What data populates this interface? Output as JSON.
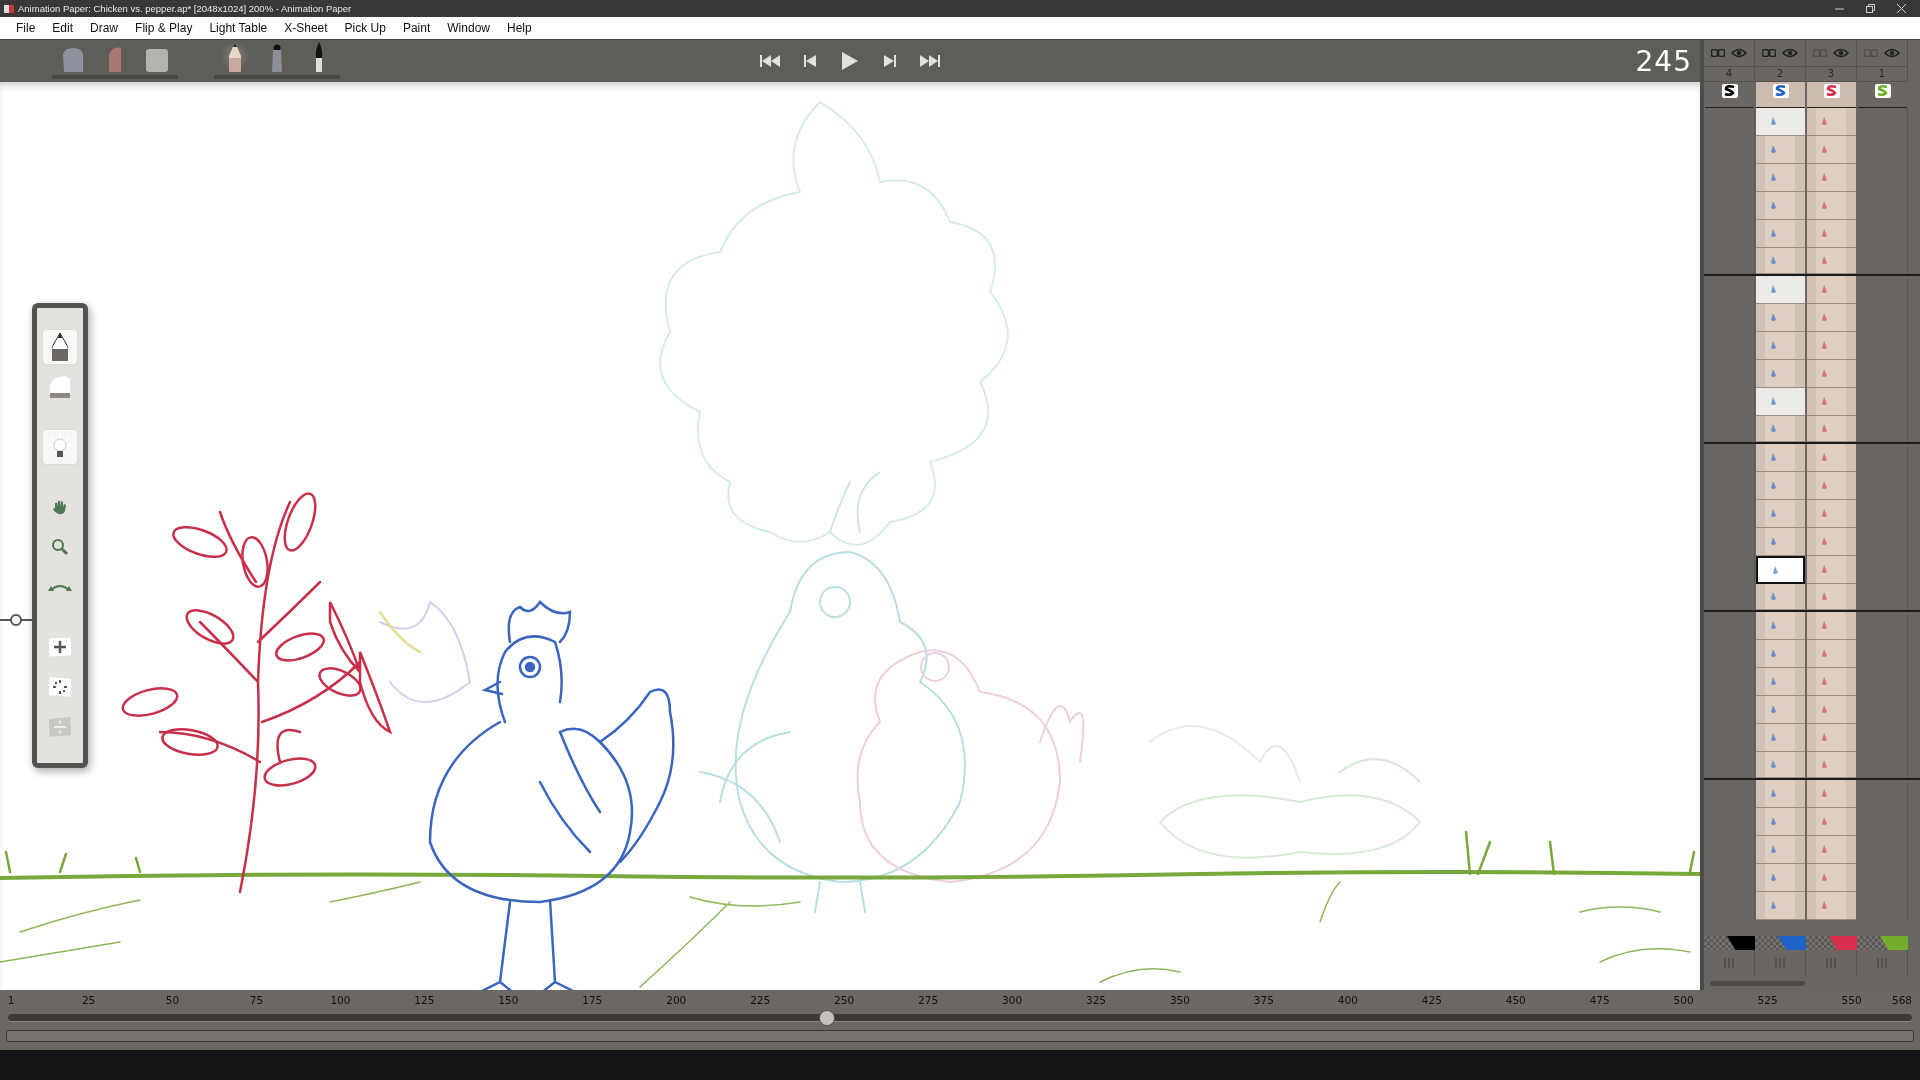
{
  "window": {
    "title": "Animation Paper: Chicken vs. pepper.ap* [2048x1024] 200% - Animation Paper"
  },
  "menu": [
    "File",
    "Edit",
    "Draw",
    "Flip & Play",
    "Light Table",
    "X-Sheet",
    "Pick Up",
    "Paint",
    "Window",
    "Help"
  ],
  "toolbar": {
    "groups": [
      [
        {
          "kind": "block-eraser",
          "selected": false
        },
        {
          "kind": "soft-eraser",
          "selected": false
        },
        {
          "kind": "square-eraser",
          "selected": false
        }
      ],
      [
        {
          "kind": "pencil",
          "selected": true
        },
        {
          "kind": "pen",
          "selected": false
        },
        {
          "kind": "brush",
          "selected": false
        }
      ]
    ],
    "transport": [
      {
        "kind": "first"
      },
      {
        "kind": "prev"
      },
      {
        "kind": "play"
      },
      {
        "kind": "next"
      },
      {
        "kind": "last"
      }
    ],
    "frame": "245"
  },
  "palette": {
    "groups": [
      [
        {
          "kind": "pencil",
          "selected": true,
          "disabled": false
        },
        {
          "kind": "eraser",
          "selected": false,
          "disabled": false
        }
      ],
      [
        {
          "kind": "light",
          "selected": true,
          "disabled": false
        }
      ],
      [
        {
          "kind": "hand",
          "selected": false,
          "disabled": false
        },
        {
          "kind": "zoom",
          "selected": false,
          "disabled": false
        },
        {
          "kind": "rotate",
          "selected": false,
          "disabled": false
        }
      ],
      [
        {
          "kind": "add",
          "selected": false,
          "disabled": false
        },
        {
          "kind": "scatter",
          "selected": false,
          "disabled": false
        },
        {
          "kind": "divide",
          "selected": false,
          "disabled": true
        }
      ]
    ]
  },
  "xsheet": {
    "columns": [
      {
        "number": "4",
        "color": "#000000",
        "linked": true,
        "filled": false
      },
      {
        "number": "2",
        "color": "#1f63c9",
        "linked": true,
        "filled": true
      },
      {
        "number": "3",
        "color": "#d8304c",
        "linked": false,
        "filled": true
      },
      {
        "number": "1",
        "color": "#72ae2c",
        "linked": false,
        "filled": false
      }
    ],
    "rows": [
      {
        "key": true,
        "selected": false
      },
      {
        "key": false,
        "selected": false
      },
      {
        "key": false,
        "selected": false
      },
      {
        "key": false,
        "selected": false
      },
      {
        "key": false,
        "selected": false
      },
      {
        "key": false,
        "selected": false
      },
      {
        "key": true,
        "selected": false
      },
      {
        "key": false,
        "selected": false
      },
      {
        "key": false,
        "selected": false
      },
      {
        "key": false,
        "selected": false
      },
      {
        "key": true,
        "selected": false
      },
      {
        "key": false,
        "selected": false
      },
      {
        "key": false,
        "selected": false
      },
      {
        "key": false,
        "selected": false
      },
      {
        "key": false,
        "selected": false
      },
      {
        "key": false,
        "selected": false
      },
      {
        "key": false,
        "selected": true
      },
      {
        "key": false,
        "selected": false
      },
      {
        "key": false,
        "selected": false
      },
      {
        "key": false,
        "selected": false
      },
      {
        "key": false,
        "selected": false
      },
      {
        "key": false,
        "selected": false
      },
      {
        "key": false,
        "selected": false
      },
      {
        "key": false,
        "selected": false
      },
      {
        "key": false,
        "selected": false
      },
      {
        "key": false,
        "selected": false
      },
      {
        "key": false,
        "selected": false
      },
      {
        "key": false,
        "selected": false
      },
      {
        "key": false,
        "selected": false
      }
    ]
  },
  "timeline": {
    "labels": [
      "1",
      "25",
      "50",
      "75",
      "100",
      "125",
      "150",
      "175",
      "200",
      "225",
      "250",
      "275",
      "300",
      "325",
      "350",
      "375",
      "400",
      "425",
      "450",
      "475",
      "500",
      "525",
      "550",
      "568"
    ],
    "level": 0.43
  }
}
